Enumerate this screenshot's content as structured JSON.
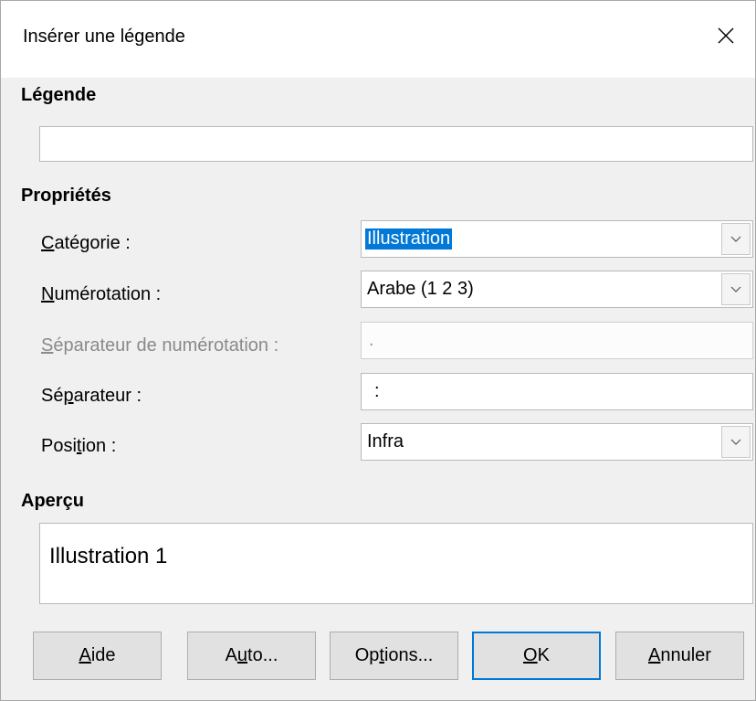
{
  "window": {
    "title": "Insérer une légende"
  },
  "caption": {
    "heading": "Légende",
    "value": ""
  },
  "properties": {
    "heading": "Propriétés",
    "category": {
      "label_pre": "",
      "label_ul": "C",
      "label_post": "atégorie :",
      "value": "Illustration"
    },
    "numbering": {
      "label_pre": "",
      "label_ul": "N",
      "label_post": "umérotation :",
      "value": "Arabe (1 2 3)"
    },
    "numbering_separator": {
      "label_pre": "",
      "label_ul": "S",
      "label_post": "éparateur de numérotation :",
      "value": "."
    },
    "separator": {
      "label_pre": "Sé",
      "label_ul": "p",
      "label_post": "arateur :",
      "value": ":"
    },
    "position": {
      "label_pre": "Posi",
      "label_ul": "t",
      "label_post": "ion :",
      "value": "Infra"
    }
  },
  "preview": {
    "heading": "Aperçu",
    "text": "Illustration 1"
  },
  "buttons": {
    "help": {
      "pre": "",
      "ul": "A",
      "post": "ide"
    },
    "auto": {
      "pre": "A",
      "ul": "u",
      "post": "to..."
    },
    "options": {
      "pre": "Op",
      "ul": "t",
      "post": "ions..."
    },
    "ok": {
      "pre": "",
      "ul": "O",
      "post": "K"
    },
    "cancel": {
      "pre": "",
      "ul": "A",
      "post": "nnuler"
    }
  },
  "icons": {
    "close": "close-icon",
    "dropdown": "chevron-down-icon"
  },
  "colors": {
    "selection": "#0078d7",
    "default_button_border": "#0078d7",
    "disabled_text": "#8a8a8a"
  }
}
